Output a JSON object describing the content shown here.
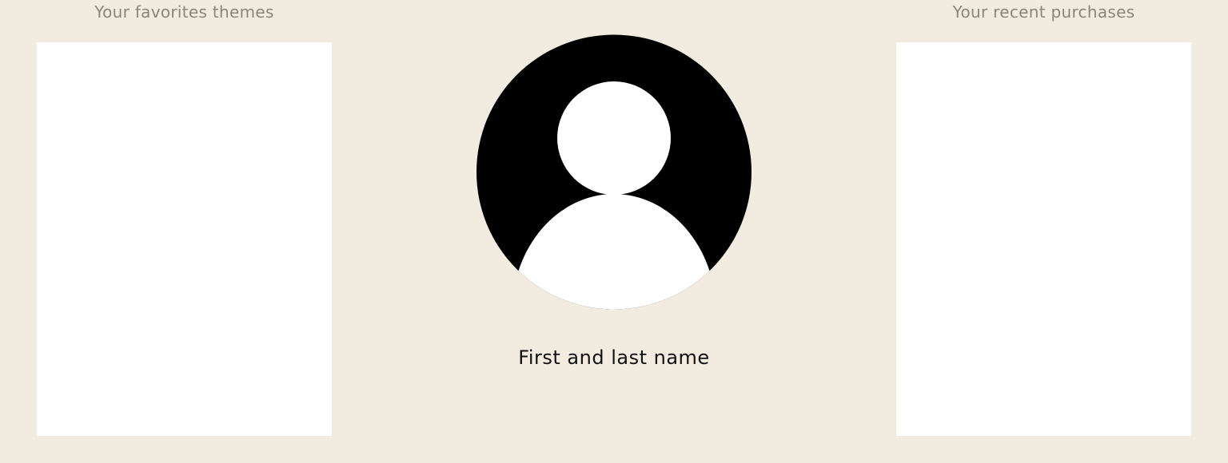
{
  "favorites": {
    "title": "Your favorites themes"
  },
  "purchases": {
    "title": "Your recent purchases"
  },
  "profile": {
    "avatar_icon": "user-avatar-icon",
    "name": "First and last name"
  },
  "colors": {
    "background": "#f2ece0",
    "panel": "#ffffff",
    "title_text": "#8a847b",
    "name_text": "#111111",
    "avatar_fill": "#000000"
  }
}
